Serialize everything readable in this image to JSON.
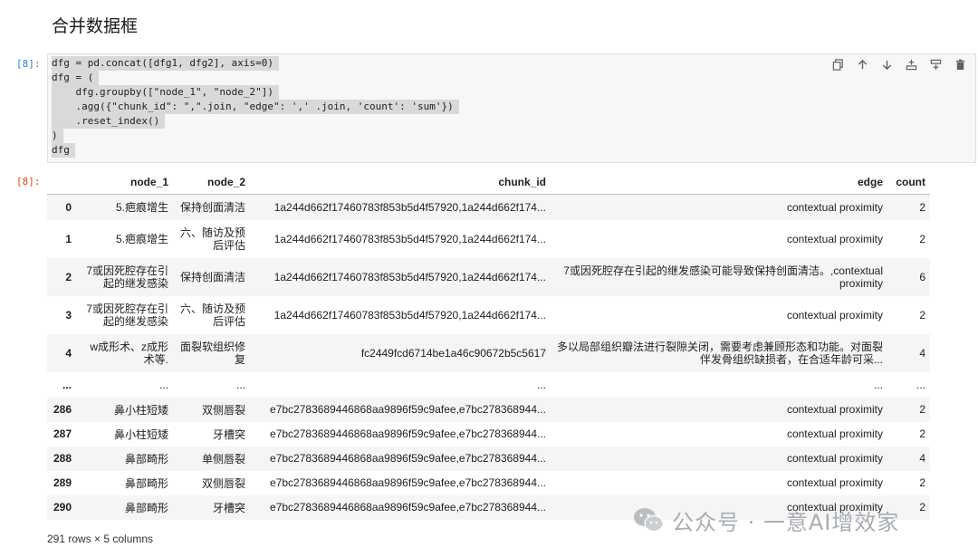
{
  "heading": "合并数据框",
  "code_cell": {
    "prompt": "[8]:",
    "lines": [
      "dfg = pd.concat([dfg1, dfg2], axis=0)",
      "dfg = (",
      "    dfg.groupby([\"node_1\", \"node_2\"])",
      "    .agg({\"chunk_id\": \",\".join, \"edge\": ',' .join, 'count': 'sum'})",
      "    .reset_index()",
      ")",
      "dfg"
    ],
    "toolbar_icons": [
      "copy-icon",
      "move-up-icon",
      "move-down-icon",
      "insert-above-icon",
      "insert-below-icon",
      "delete-icon"
    ]
  },
  "output": {
    "prompt": "[8]:",
    "columns": [
      "",
      "node_1",
      "node_2",
      "chunk_id",
      "edge",
      "count"
    ],
    "rows": [
      {
        "idx": "0",
        "node_1": "5.疤痕增生",
        "node_2": "保持创面清洁",
        "chunk_id": "1a244d662f17460783f853b5d4f57920,1a244d662f174...",
        "edge": "contextual proximity",
        "count": "2"
      },
      {
        "idx": "1",
        "node_1": "5.疤痕增生",
        "node_2": "六、随访及预后评估",
        "chunk_id": "1a244d662f17460783f853b5d4f57920,1a244d662f174...",
        "edge": "contextual proximity",
        "count": "2"
      },
      {
        "idx": "2",
        "node_1": "7或因死腔存在引起的继发感染",
        "node_2": "保持创面清洁",
        "chunk_id": "1a244d662f17460783f853b5d4f57920,1a244d662f174...",
        "edge": "7或因死腔存在引起的继发感染可能导致保持创面清洁。,contextual proximity",
        "count": "6"
      },
      {
        "idx": "3",
        "node_1": "7或因死腔存在引起的继发感染",
        "node_2": "六、随访及预后评估",
        "chunk_id": "1a244d662f17460783f853b5d4f57920,1a244d662f174...",
        "edge": "contextual proximity",
        "count": "2"
      },
      {
        "idx": "4",
        "node_1": "w成形术、z成形术等.",
        "node_2": "面裂软组织修复",
        "chunk_id": "fc2449fcd6714be1a46c90672b5c5617",
        "edge": "多以局部组织瓣法进行裂隙关闭，需要考虑兼顾形态和功能。对面裂伴发骨组织缺损者，在合适年龄可采...",
        "count": "4"
      },
      {
        "idx": "...",
        "node_1": "...",
        "node_2": "...",
        "chunk_id": "...",
        "edge": "...",
        "count": "..."
      },
      {
        "idx": "286",
        "node_1": "鼻小柱短矮",
        "node_2": "双侧唇裂",
        "chunk_id": "e7bc2783689446868aa9896f59c9afee,e7bc278368944...",
        "edge": "contextual proximity",
        "count": "2"
      },
      {
        "idx": "287",
        "node_1": "鼻小柱短矮",
        "node_2": "牙槽突",
        "chunk_id": "e7bc2783689446868aa9896f59c9afee,e7bc278368944...",
        "edge": "contextual proximity",
        "count": "2"
      },
      {
        "idx": "288",
        "node_1": "鼻部畸形",
        "node_2": "单侧唇裂",
        "chunk_id": "e7bc2783689446868aa9896f59c9afee,e7bc278368944...",
        "edge": "contextual proximity",
        "count": "4"
      },
      {
        "idx": "289",
        "node_1": "鼻部畸形",
        "node_2": "双侧唇裂",
        "chunk_id": "e7bc2783689446868aa9896f59c9afee,e7bc278368944...",
        "edge": "contextual proximity",
        "count": "2"
      },
      {
        "idx": "290",
        "node_1": "鼻部畸形",
        "node_2": "牙槽突",
        "chunk_id": "e7bc2783689446868aa9896f59c9afee,e7bc278368944...",
        "edge": "contextual proximity",
        "count": "2"
      }
    ],
    "footer": "291 rows × 5 columns"
  },
  "watermark": "公众号 · 一意AI增效家",
  "colors": {
    "prompt_in": "#307fc1",
    "prompt_out": "#d84315",
    "code_bg": "#f7f7f7",
    "selection": "#d9d9d9",
    "stripe": "#f5f5f5"
  }
}
